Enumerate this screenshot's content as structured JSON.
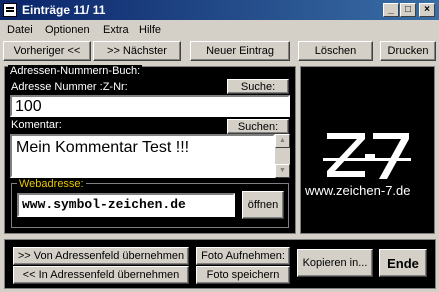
{
  "window": {
    "title": "Einträge 11/ 11",
    "controls": [
      "_",
      "□",
      "×"
    ]
  },
  "menu": [
    "Datei",
    "Optionen",
    "Extra",
    "Hilfe"
  ],
  "toolbar": {
    "prev": "Vorheriger <<",
    "next": ">> Nächster",
    "new": "Neuer Eintrag",
    "delete": "Löschen",
    "print": "Drucken"
  },
  "group": {
    "title": "Adressen-Nummern-Buch:",
    "address_label": "Adresse Nummer :Z-Nr:",
    "search_button": "Suche:",
    "address_value": "100",
    "comment_label": "Komentar:",
    "comment_search_button": "Suchen:",
    "comment_value": "Mein Kommentar Test !!!",
    "web_label": "Webadresse:",
    "web_value": "www.symbol-zeichen.de",
    "open_button": "öffnen"
  },
  "logo": {
    "mark": "Z-7",
    "url": "www.zeichen-7.de"
  },
  "bottom": {
    "from_address": ">> Von Adressenfeld übernehmen",
    "to_address": "<< In Adressenfeld übernehmen",
    "photo_take": "Foto Aufnehmen:",
    "photo_save": "Foto speichern",
    "copy_into": "Kopieren in...",
    "end": "Ende"
  }
}
